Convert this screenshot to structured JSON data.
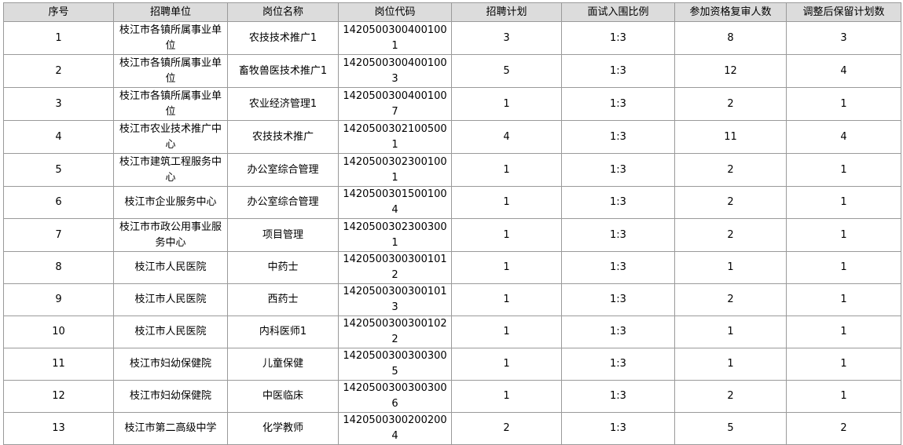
{
  "table": {
    "headers": [
      "序号",
      "招聘单位",
      "岗位名称",
      "岗位代码",
      "招聘计划",
      "面试入围比例",
      "参加资格复审人数",
      "调整后保留计划数"
    ],
    "rows": [
      [
        "1",
        "枝江市各镇所属事业单位",
        "农技技术推广1",
        "14205003004001001",
        "3",
        "1:3",
        "8",
        "3"
      ],
      [
        "2",
        "枝江市各镇所属事业单位",
        "畜牧兽医技术推广1",
        "14205003004001003",
        "5",
        "1:3",
        "12",
        "4"
      ],
      [
        "3",
        "枝江市各镇所属事业单位",
        "农业经济管理1",
        "14205003004001007",
        "1",
        "1:3",
        "2",
        "1"
      ],
      [
        "4",
        "枝江市农业技术推广中心",
        "农技技术推广",
        "14205003021005001",
        "4",
        "1:3",
        "11",
        "4"
      ],
      [
        "5",
        "枝江市建筑工程服务中心",
        "办公室综合管理",
        "14205003023001001",
        "1",
        "1:3",
        "2",
        "1"
      ],
      [
        "6",
        "枝江市企业服务中心",
        "办公室综合管理",
        "14205003015001004",
        "1",
        "1:3",
        "2",
        "1"
      ],
      [
        "7",
        "枝江市市政公用事业服务中心",
        "项目管理",
        "14205003023003001",
        "1",
        "1:3",
        "2",
        "1"
      ],
      [
        "8",
        "枝江市人民医院",
        "中药士",
        "14205003003001012",
        "1",
        "1:3",
        "1",
        "1"
      ],
      [
        "9",
        "枝江市人民医院",
        "西药士",
        "14205003003001013",
        "1",
        "1:3",
        "2",
        "1"
      ],
      [
        "10",
        "枝江市人民医院",
        "内科医师1",
        "14205003003001022",
        "1",
        "1:3",
        "1",
        "1"
      ],
      [
        "11",
        "枝江市妇幼保健院",
        "儿童保健",
        "14205003003003005",
        "1",
        "1:3",
        "1",
        "1"
      ],
      [
        "12",
        "枝江市妇幼保健院",
        "中医临床",
        "14205003003003006",
        "1",
        "1:3",
        "2",
        "1"
      ],
      [
        "13",
        "枝江市第二高级中学",
        "化学教师",
        "14205003002002004",
        "2",
        "1:3",
        "5",
        "2"
      ]
    ]
  }
}
